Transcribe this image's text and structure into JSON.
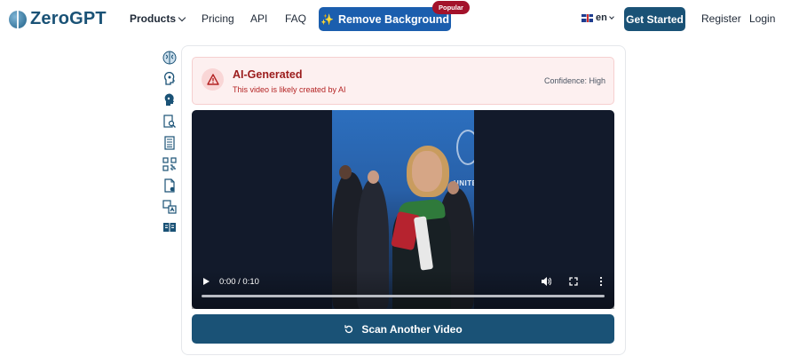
{
  "header": {
    "logo_text": "ZeroGPT",
    "nav": {
      "products": "Products",
      "pricing": "Pricing",
      "api": "API",
      "faq": "FAQ"
    },
    "remove_background": "Remove Background",
    "popular_badge": "Popular",
    "language": "en",
    "get_started": "Get Started",
    "register": "Register",
    "login": "Login"
  },
  "sidebar": {
    "icons": [
      "brain-icon",
      "ai-head-icon",
      "robot-head-icon",
      "document-search-icon",
      "document-lines-icon",
      "qr-code-icon",
      "document-check-icon",
      "translate-icon",
      "book-icon"
    ]
  },
  "result": {
    "title": "AI-Generated",
    "subtitle": "This video is likely created by AI",
    "confidence": "Confidence: High",
    "status_color": "#9b1c1c"
  },
  "video": {
    "time": "0:00 / 0:10",
    "progress": 0
  },
  "actions": {
    "scan_another": "Scan Another Video"
  },
  "colors": {
    "brand": "#1a5276",
    "accent": "#1b5eae",
    "badge": "#a3122b"
  }
}
